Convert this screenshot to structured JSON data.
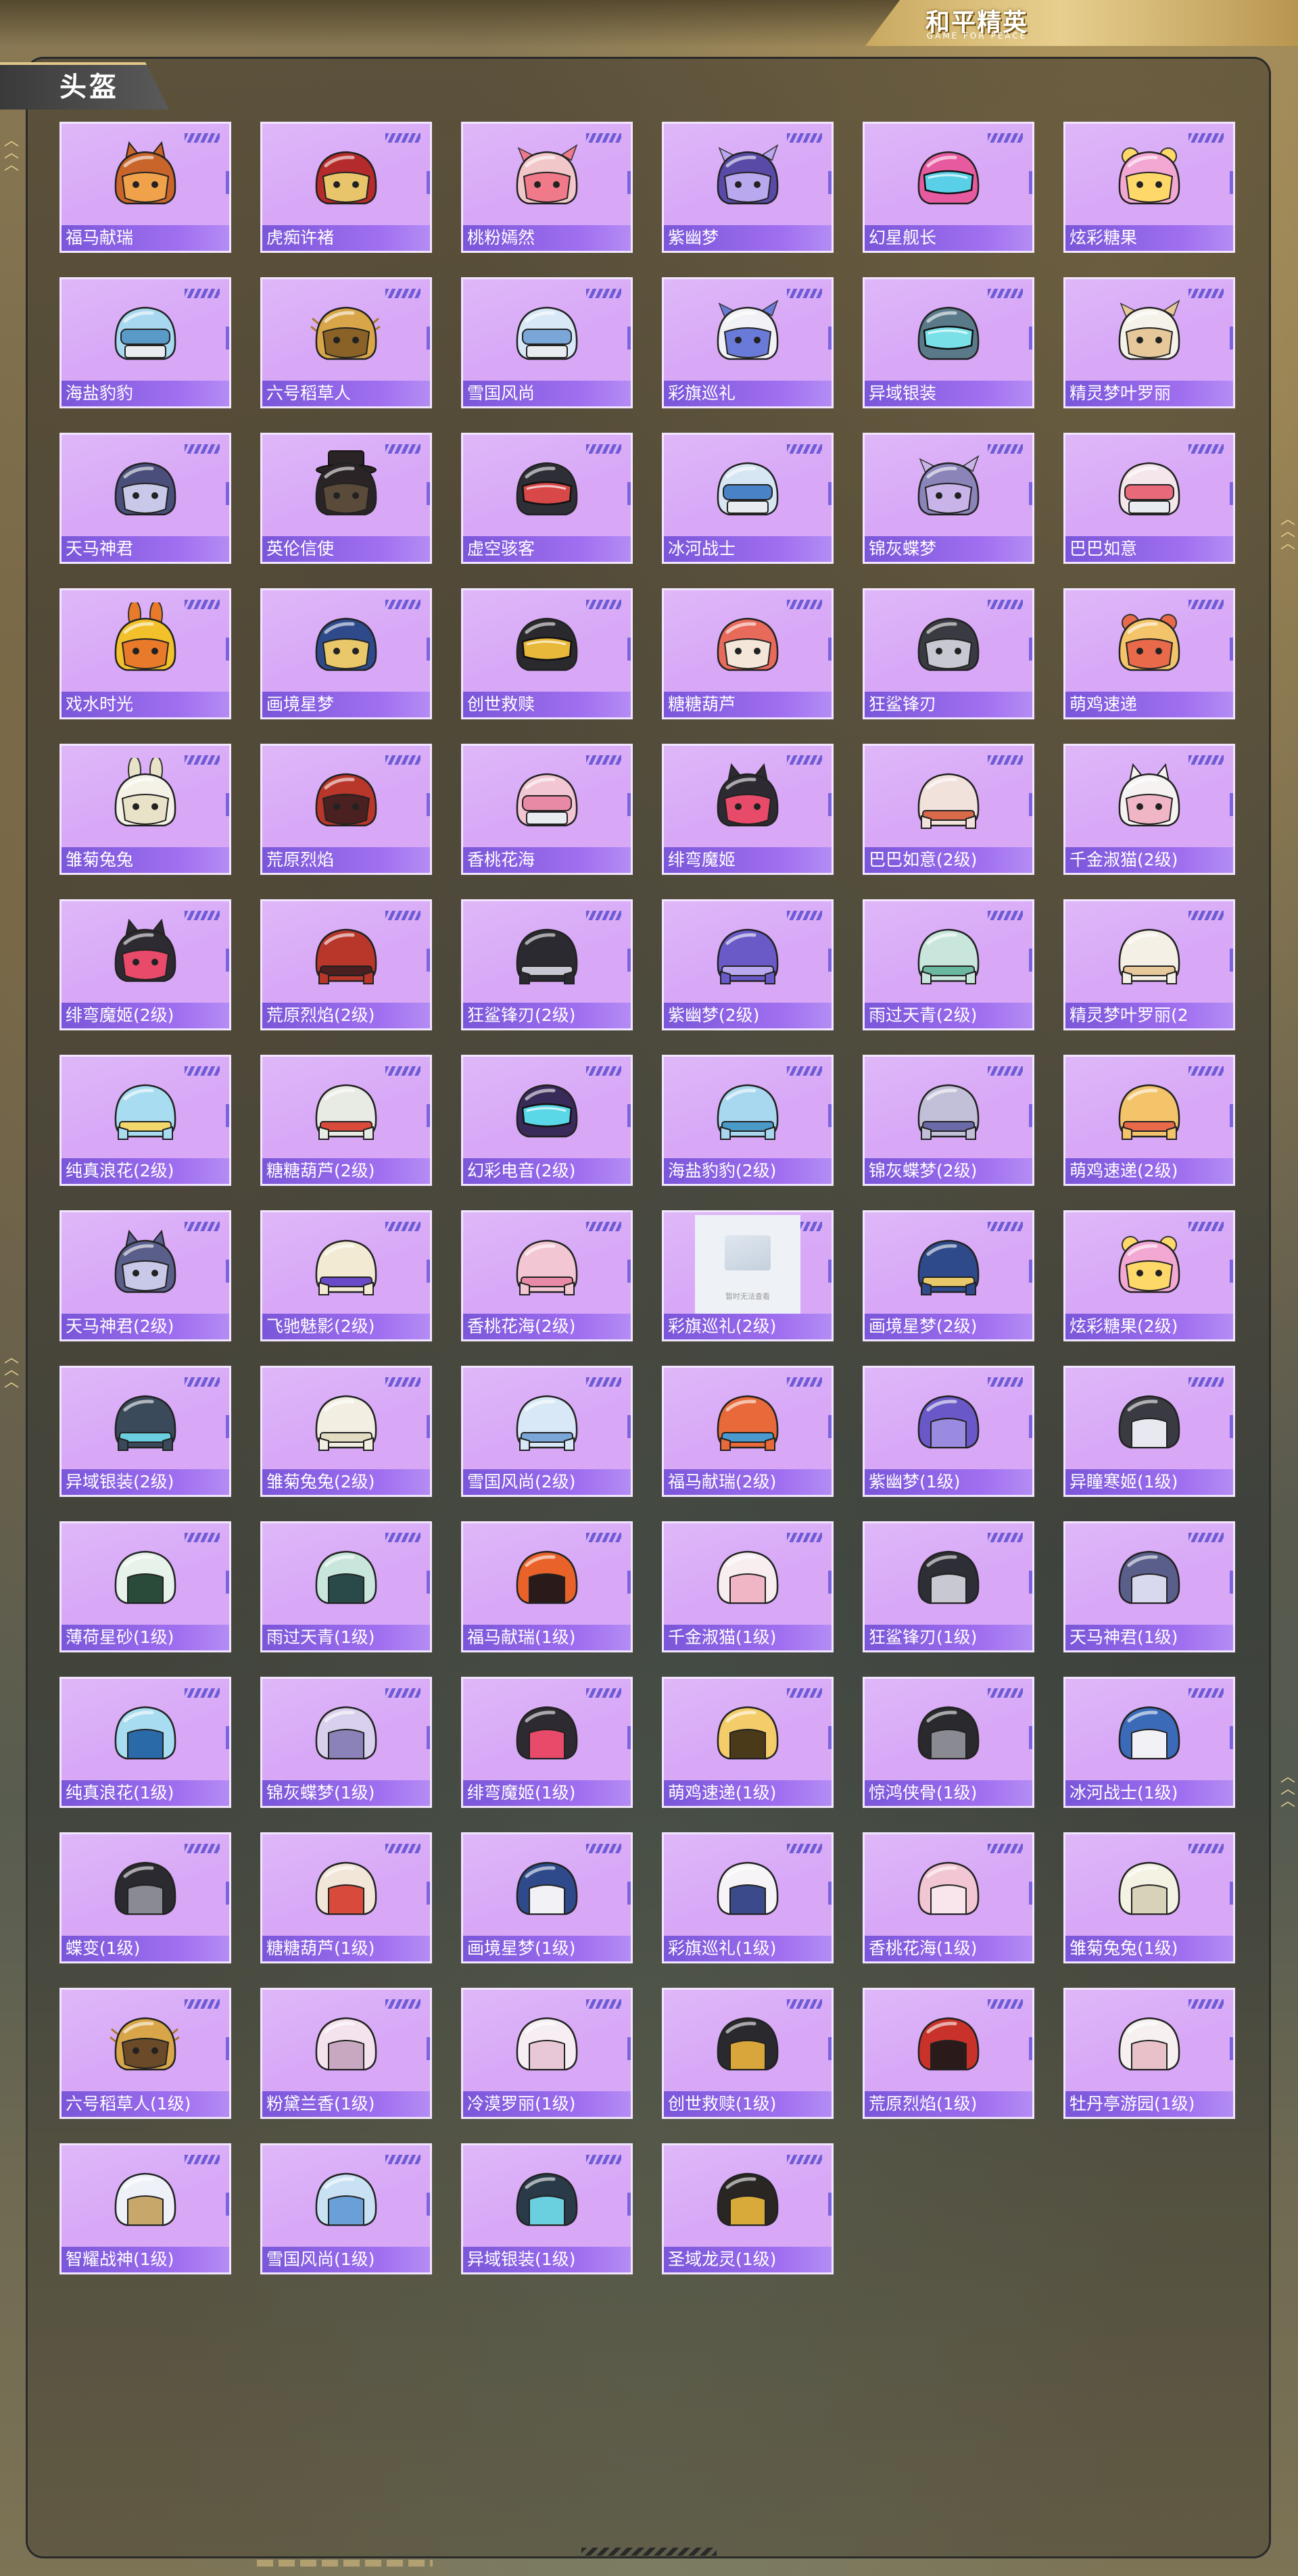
{
  "logo": {
    "title": "和平精英",
    "subtitle": "GAME FOR PEACE"
  },
  "section_title": "头盔",
  "placeholder_text": "暂时无法查看",
  "items": [
    {
      "name": "福马献瑞",
      "color": "#c9652a",
      "accent": "#f0a24a",
      "style": "cat"
    },
    {
      "name": "虎痴许褚",
      "color": "#b52a2a",
      "accent": "#e8c56a",
      "style": "mask"
    },
    {
      "name": "桃粉嫣然",
      "color": "#f2c7c9",
      "accent": "#f07a8a",
      "style": "floral"
    },
    {
      "name": "紫幽梦",
      "color": "#5a4aa8",
      "accent": "#b9a8ee",
      "style": "floral"
    },
    {
      "name": "幻星舰长",
      "color": "#e85aa0",
      "accent": "#5ad0e8",
      "style": "visor"
    },
    {
      "name": "炫彩糖果",
      "color": "#f3a7d3",
      "accent": "#ffd86a",
      "style": "bear"
    },
    {
      "name": "海盐豹豹",
      "color": "#a8d8f0",
      "accent": "#5a9ac8",
      "style": "level3"
    },
    {
      "name": "六号稻草人",
      "color": "#d8a648",
      "accent": "#8a6228",
      "style": "straw"
    },
    {
      "name": "雪国风尚",
      "color": "#d8e8f6",
      "accent": "#7aa6d8",
      "style": "level3"
    },
    {
      "name": "彩旗巡礼",
      "color": "#f2f2f6",
      "accent": "#6a7ad8",
      "style": "floral"
    },
    {
      "name": "异域银装",
      "color": "#5a7a8a",
      "accent": "#7ae0e8",
      "style": "visor"
    },
    {
      "name": "精灵梦叶罗丽",
      "color": "#f5f2ea",
      "accent": "#e6c89a",
      "style": "floral"
    },
    {
      "name": "天马神君",
      "color": "#4a4e7a",
      "accent": "#c8c8e8",
      "style": "mask"
    },
    {
      "name": "英伦信使",
      "color": "#2a2426",
      "accent": "#5a4a3a",
      "style": "hat"
    },
    {
      "name": "虚空骇客",
      "color": "#2e2e36",
      "accent": "#d84848",
      "style": "visor"
    },
    {
      "name": "冰河战士",
      "color": "#d6e6f2",
      "accent": "#4a82c8",
      "style": "level3"
    },
    {
      "name": "锦灰蝶梦",
      "color": "#8a84b8",
      "accent": "#c8b4e8",
      "style": "floral"
    },
    {
      "name": "巴巴如意",
      "color": "#f4e6ea",
      "accent": "#e86a7a",
      "style": "level3"
    },
    {
      "name": "戏水时光",
      "color": "#f2c02a",
      "accent": "#e87a2a",
      "style": "bunny"
    },
    {
      "name": "画境星梦",
      "color": "#2e4a8a",
      "accent": "#e8c86a",
      "style": "mask"
    },
    {
      "name": "创世救赎",
      "color": "#2a2a2e",
      "accent": "#e8b83a",
      "style": "visor"
    },
    {
      "name": "糖糖葫芦",
      "color": "#e86a5a",
      "accent": "#f4e6d8",
      "style": "mask"
    },
    {
      "name": "狂鲨锋刃",
      "color": "#3a3a42",
      "accent": "#c8c8d2",
      "style": "mask"
    },
    {
      "name": "萌鸡速递",
      "color": "#f4c46a",
      "accent": "#e86a4a",
      "style": "bear"
    },
    {
      "name": "雏菊兔兔",
      "color": "#f4f2e6",
      "accent": "#e8e2c8",
      "style": "bunny"
    },
    {
      "name": "荒原烈焰",
      "color": "#b8362a",
      "accent": "#4a2020",
      "style": "mask"
    },
    {
      "name": "香桃花海",
      "color": "#f2c6d2",
      "accent": "#e88aa6",
      "style": "level3"
    },
    {
      "name": "绯弯魔姬",
      "color": "#2e2a32",
      "accent": "#e84a6a",
      "style": "cat"
    },
    {
      "name": "巴巴如意(2级)",
      "color": "#f2e2dc",
      "accent": "#d86a4a",
      "style": "level2"
    },
    {
      "name": "千金淑猫(2级)",
      "color": "#f6f2f2",
      "accent": "#f0b6c6",
      "style": "cat"
    },
    {
      "name": "绯弯魔姬(2级)",
      "color": "#2e2a32",
      "accent": "#e84a6a",
      "style": "cat"
    },
    {
      "name": "荒原烈焰(2级)",
      "color": "#b8362a",
      "accent": "#4a2020",
      "style": "level2"
    },
    {
      "name": "狂鲨锋刃(2级)",
      "color": "#2a2a30",
      "accent": "#c8c8d2",
      "style": "level2"
    },
    {
      "name": "紫幽梦(2级)",
      "color": "#6a5ac8",
      "accent": "#b8a8ee",
      "style": "level2"
    },
    {
      "name": "雨过天青(2级)",
      "color": "#c8e6dc",
      "accent": "#6ab8a0",
      "style": "level2"
    },
    {
      "name": "精灵梦叶罗丽(2",
      "color": "#f5f0e6",
      "accent": "#e6c89a",
      "style": "level2"
    },
    {
      "name": "纯真浪花(2级)",
      "color": "#a8dcf0",
      "accent": "#f2d86a",
      "style": "level2"
    },
    {
      "name": "糖糖葫芦(2级)",
      "color": "#e8eae4",
      "accent": "#d84a3a",
      "style": "level2"
    },
    {
      "name": "幻彩电音(2级)",
      "color": "#3a2a5a",
      "accent": "#5ad8e8",
      "style": "visor"
    },
    {
      "name": "海盐豹豹(2级)",
      "color": "#a8d8f0",
      "accent": "#4a9ac8",
      "style": "level2"
    },
    {
      "name": "锦灰蝶梦(2级)",
      "color": "#c2c0d8",
      "accent": "#6a6aa8",
      "style": "level2"
    },
    {
      "name": "萌鸡速递(2级)",
      "color": "#f4c46a",
      "accent": "#e86a4a",
      "style": "level2"
    },
    {
      "name": "天马神君(2级)",
      "color": "#5a5e8a",
      "accent": "#c8c8e8",
      "style": "cat"
    },
    {
      "name": "飞驰魅影(2级)",
      "color": "#f2ead2",
      "accent": "#6a4ac8",
      "style": "level2"
    },
    {
      "name": "香桃花海(2级)",
      "color": "#f2c6d2",
      "accent": "#e88aa6",
      "style": "level2"
    },
    {
      "name": "彩旗巡礼(2级)",
      "color": "#eef1f6",
      "accent": "#c6d1de",
      "style": "placeholder"
    },
    {
      "name": "画境星梦(2级)",
      "color": "#2e4a8a",
      "accent": "#e8c86a",
      "style": "level2"
    },
    {
      "name": "炫彩糖果(2级)",
      "color": "#f3a7d3",
      "accent": "#ffd86a",
      "style": "bear"
    },
    {
      "name": "异域银装(2级)",
      "color": "#3a4a5a",
      "accent": "#6ad0e0",
      "style": "level2"
    },
    {
      "name": "雏菊兔兔(2级)",
      "color": "#f2efe2",
      "accent": "#e2dcc2",
      "style": "level2"
    },
    {
      "name": "雪国风尚(2级)",
      "color": "#d8e8f6",
      "accent": "#7aa6d8",
      "style": "level2"
    },
    {
      "name": "福马献瑞(2级)",
      "color": "#e86a3a",
      "accent": "#4a9ad0",
      "style": "level2"
    },
    {
      "name": "紫幽梦(1级)",
      "color": "#6a58c8",
      "accent": "#9a8ae0",
      "style": "level1"
    },
    {
      "name": "异瞳寒姬(1级)",
      "color": "#3a3a42",
      "accent": "#e8e8f0",
      "style": "level1"
    },
    {
      "name": "薄荷星砂(1级)",
      "color": "#e6f2ea",
      "accent": "#2a4a3a",
      "style": "level1"
    },
    {
      "name": "雨过天青(1级)",
      "color": "#c8e6dc",
      "accent": "#2a4a4a",
      "style": "level1"
    },
    {
      "name": "福马献瑞(1级)",
      "color": "#e8622a",
      "accent": "#2a1a1a",
      "style": "level1"
    },
    {
      "name": "千金淑猫(1级)",
      "color": "#f8eef0",
      "accent": "#f0b6c6",
      "style": "level1"
    },
    {
      "name": "狂鲨锋刃(1级)",
      "color": "#2e2e36",
      "accent": "#c8c8d2",
      "style": "level1"
    },
    {
      "name": "天马神君(1级)",
      "color": "#5a5e8a",
      "accent": "#d8d8ee",
      "style": "level1"
    },
    {
      "name": "纯真浪花(1级)",
      "color": "#a8dcf0",
      "accent": "#2a6aa8",
      "style": "level1"
    },
    {
      "name": "锦灰蝶梦(1级)",
      "color": "#d8d0ec",
      "accent": "#8a82b8",
      "style": "level1"
    },
    {
      "name": "绯弯魔姬(1级)",
      "color": "#2e2a32",
      "accent": "#e84a6a",
      "style": "level1"
    },
    {
      "name": "萌鸡速递(1级)",
      "color": "#f4cc6a",
      "accent": "#4a3a1a",
      "style": "level1"
    },
    {
      "name": "惊鸿侠骨(1级)",
      "color": "#2a2a2e",
      "accent": "#8a8a92",
      "style": "level1"
    },
    {
      "name": "冰河战士(1级)",
      "color": "#3a6ab8",
      "accent": "#f2f2f6",
      "style": "level1"
    },
    {
      "name": "蝶变(1级)",
      "color": "#2a2a30",
      "accent": "#8a8a94",
      "style": "level1"
    },
    {
      "name": "糖糖葫芦(1级)",
      "color": "#f2e6d8",
      "accent": "#d84a3a",
      "style": "level1"
    },
    {
      "name": "画境星梦(1级)",
      "color": "#2e4a8a",
      "accent": "#f2f2f6",
      "style": "level1"
    },
    {
      "name": "彩旗巡礼(1级)",
      "color": "#f6f4f6",
      "accent": "#3a4a8a",
      "style": "level1"
    },
    {
      "name": "香桃花海(1级)",
      "color": "#f2c6d2",
      "accent": "#f8e6ec",
      "style": "level1"
    },
    {
      "name": "雏菊兔兔(1级)",
      "color": "#f4f2e2",
      "accent": "#d8d2b8",
      "style": "level1"
    },
    {
      "name": "六号稻草人(1级)",
      "color": "#d8a648",
      "accent": "#6a4a28",
      "style": "straw"
    },
    {
      "name": "粉黛兰香(1级)",
      "color": "#f4e2ec",
      "accent": "#c8a8c0",
      "style": "level1"
    },
    {
      "name": "冷漠罗丽(1级)",
      "color": "#f6eef2",
      "accent": "#e8c8d6",
      "style": "level1"
    },
    {
      "name": "创世救赎(1级)",
      "color": "#2a2a2e",
      "accent": "#d8a63a",
      "style": "level1"
    },
    {
      "name": "荒原烈焰(1级)",
      "color": "#c8322a",
      "accent": "#2a1a1a",
      "style": "level1"
    },
    {
      "name": "牡丹亭游园(1级)",
      "color": "#f6f0f0",
      "accent": "#e8c2c8",
      "style": "level1"
    },
    {
      "name": "智耀战神(1级)",
      "color": "#eef2f8",
      "accent": "#c8a86a",
      "style": "level1"
    },
    {
      "name": "雪国风尚(1级)",
      "color": "#c8e2f4",
      "accent": "#6aa0d8",
      "style": "level1"
    },
    {
      "name": "异域银装(1级)",
      "color": "#2a3a48",
      "accent": "#6ad0e0",
      "style": "level1"
    },
    {
      "name": "圣域龙灵(1级)",
      "color": "#2a2624",
      "accent": "#d8aa3a",
      "style": "level1"
    }
  ]
}
